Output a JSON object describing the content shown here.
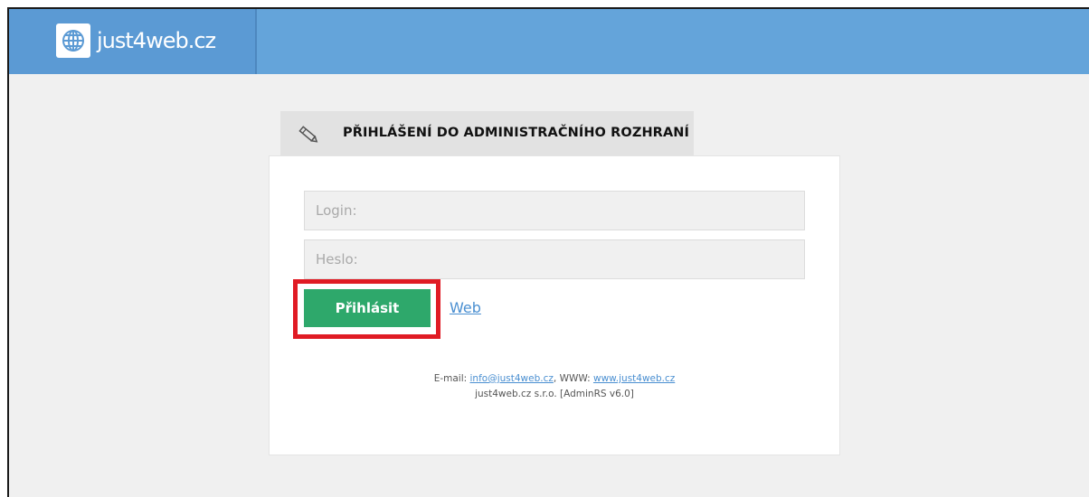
{
  "header": {
    "brand": "just4web.cz",
    "icon": "globe-icon"
  },
  "login_panel": {
    "title": "PŘIHLÁŠENÍ DO ADMINISTRAČNÍHO ROZHRANÍ",
    "title_icon": "pencil-icon",
    "login_placeholder": "Login:",
    "login_value": "",
    "password_placeholder": "Heslo:",
    "password_value": "",
    "submit_label": "Přihlásit",
    "web_link": "Web"
  },
  "footer": {
    "email_label": "E-mail:",
    "email": "info@just4web.cz",
    "separator": ",",
    "www_label": "WWW:",
    "www": "www.just4web.cz",
    "company_line": "just4web.cz s.r.o. [AdminRS v6.0]"
  },
  "colors": {
    "header": "#64a4da",
    "button": "#2ea86b",
    "highlight": "#e01b24",
    "link": "#4a8fd1"
  }
}
